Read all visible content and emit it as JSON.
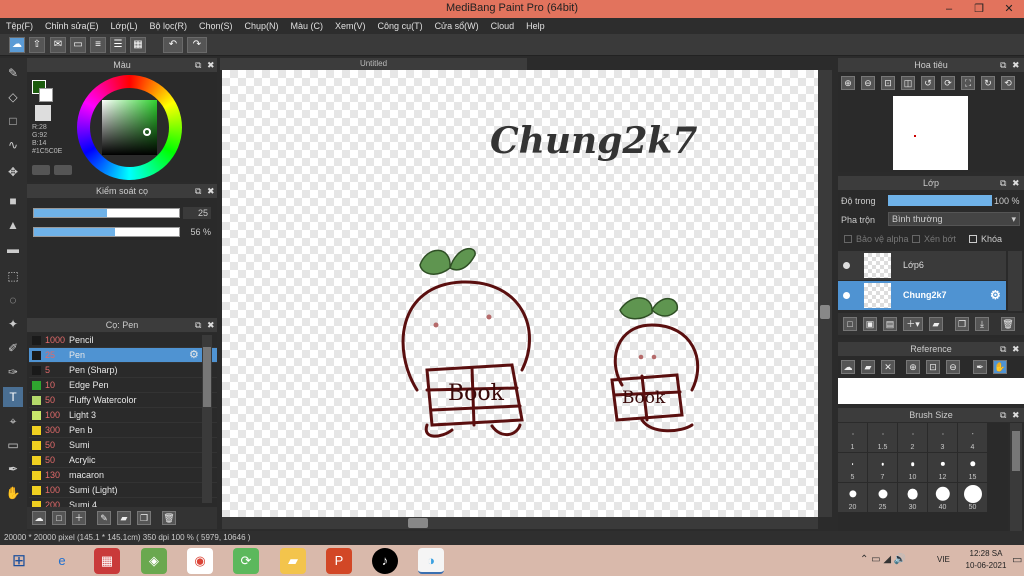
{
  "window": {
    "title": "MediBang Paint Pro (64bit)",
    "minimize": "–",
    "restore": "❐",
    "close": "✕"
  },
  "menu": [
    "Tệp(F)",
    "Chỉnh sửa(E)",
    "Lớp(L)",
    "Bộ lọc(R)",
    "Chọn(S)",
    "Chụp(N)",
    "Màu (C)",
    "Xem(V)",
    "Công cụ(T)",
    "Cửa sổ(W)",
    "Cloud",
    "Help"
  ],
  "toolbar": {
    "undo": "↶",
    "redo": "↷"
  },
  "document": {
    "tab": "Untitled"
  },
  "color_panel": {
    "title": "Màu",
    "r": "R:28",
    "g": "G:92",
    "b": "B:14",
    "hex": "#1C5C0E",
    "primary": "#1c5c0e"
  },
  "brush_control": {
    "title": "Kiểm soát cọ",
    "size_value": "25",
    "size_fraction": 0.5,
    "opacity_value": "56 %",
    "opacity_fraction": 0.56
  },
  "brush_panel": {
    "title": "Cọ: Pen",
    "items": [
      {
        "size": "1000",
        "name": "Pencil",
        "color": "#1a1a1a"
      },
      {
        "size": "25",
        "name": "Pen",
        "color": "#1a1a1a"
      },
      {
        "size": "5",
        "name": "Pen (Sharp)",
        "color": "#1a1a1a"
      },
      {
        "size": "10",
        "name": "Edge Pen",
        "color": "#2fa52f"
      },
      {
        "size": "50",
        "name": "Fluffy Watercolor",
        "color": "#b5d96a"
      },
      {
        "size": "100",
        "name": "Light 3",
        "color": "#c8e86b"
      },
      {
        "size": "300",
        "name": "Pen b",
        "color": "#f0d020"
      },
      {
        "size": "50",
        "name": "Sumi",
        "color": "#f0d020"
      },
      {
        "size": "50",
        "name": "Acrylic",
        "color": "#f0d020"
      },
      {
        "size": "130",
        "name": "macaron",
        "color": "#f0d020"
      },
      {
        "size": "100",
        "name": "Sumi (Light)",
        "color": "#f0d020"
      },
      {
        "size": "200",
        "name": "Sumi 4",
        "color": "#f0d020"
      }
    ]
  },
  "canvas": {
    "signature": "Chung2k7",
    "book_label_1": "Book",
    "book_label_2": "Book",
    "ink": "#5a0f0f",
    "leaf": "#5f9550"
  },
  "navigator": {
    "title": "Hoa tiêu"
  },
  "layer_panel": {
    "title": "Lớp",
    "opacity_label": "Độ trong",
    "opacity_value": "100 %",
    "blend_label": "Pha trộn",
    "blend_value": "Bình thường",
    "protect_alpha": "Bảo vệ alpha",
    "clipping": "Xén bớt",
    "lock": "Khóa",
    "layers": [
      {
        "name": "Lớp6"
      },
      {
        "name": "Chung2k7"
      }
    ]
  },
  "reference_panel": {
    "title": "Reference"
  },
  "brush_size_panel": {
    "title": "Brush Size",
    "sizes": [
      "1",
      "1.5",
      "2",
      "3",
      "4",
      "5",
      "7",
      "10",
      "12",
      "15",
      "20",
      "25",
      "30",
      "40",
      "50"
    ]
  },
  "status": {
    "text": "20000 * 20000 pixel  (145.1 * 145.1cm)  350 dpi  100 %  ( 5979, 10646 )"
  },
  "taskbar": {
    "time": "12:28 SA",
    "date": "10-06-2021",
    "lang": "VIE"
  }
}
